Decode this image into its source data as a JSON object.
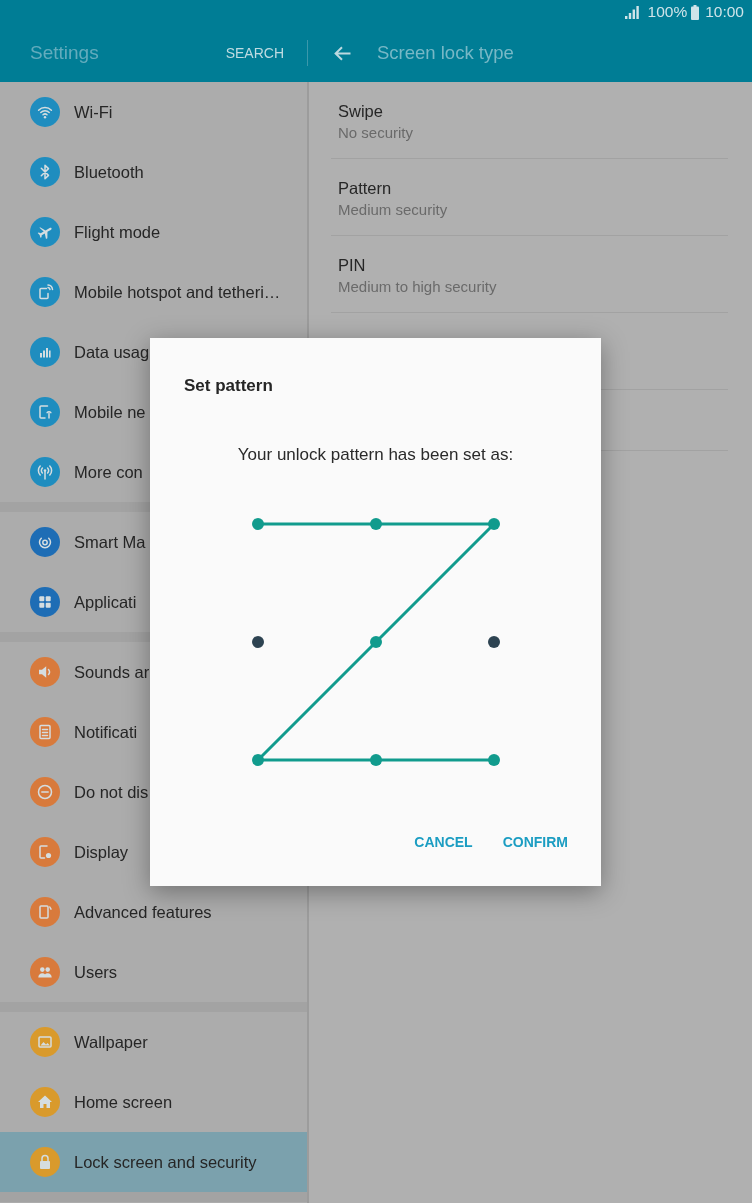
{
  "status_bar": {
    "battery": "100%",
    "time": "10:00"
  },
  "header": {
    "title": "Settings",
    "search": "SEARCH",
    "page_title": "Screen lock type"
  },
  "sidebar": {
    "groups": [
      {
        "items": [
          {
            "label": "Wi-Fi",
            "color": "#1f8dbf",
            "selected": false
          },
          {
            "label": "Bluetooth",
            "color": "#1f8dbf",
            "selected": false
          },
          {
            "label": "Flight mode",
            "color": "#1f8dbf",
            "selected": false
          },
          {
            "label": "Mobile hotspot and tetheri…",
            "color": "#1f8dbf",
            "selected": false
          },
          {
            "label": "Data usag",
            "color": "#1f8dbf",
            "selected": false
          },
          {
            "label": "Mobile ne",
            "color": "#1f8dbf",
            "selected": false
          },
          {
            "label": "More con",
            "color": "#1f8dbf",
            "selected": false
          }
        ]
      },
      {
        "items": [
          {
            "label": "Smart Ma",
            "color": "#1e6db5",
            "selected": false
          },
          {
            "label": "Applicati",
            "color": "#1e6db5",
            "selected": false
          }
        ]
      },
      {
        "items": [
          {
            "label": "Sounds ar",
            "color": "#d87a3c",
            "selected": false
          },
          {
            "label": "Notificati",
            "color": "#d87a3c",
            "selected": false
          },
          {
            "label": "Do not dis",
            "color": "#d87a3c",
            "selected": false
          },
          {
            "label": "Display",
            "color": "#d87a3c",
            "selected": false
          },
          {
            "label": "Advanced features",
            "color": "#d87a3c",
            "selected": false
          },
          {
            "label": "Users",
            "color": "#d87a3c",
            "selected": false
          }
        ]
      },
      {
        "items": [
          {
            "label": "Wallpaper",
            "color": "#d99a2c",
            "selected": false
          },
          {
            "label": "Home screen",
            "color": "#d99a2c",
            "selected": false
          },
          {
            "label": "Lock screen and security",
            "color": "#d99a2c",
            "selected": true
          }
        ]
      }
    ]
  },
  "lock_types": [
    {
      "title": "Swipe",
      "subtitle": "No security"
    },
    {
      "title": "Pattern",
      "subtitle": "Medium security"
    },
    {
      "title": "PIN",
      "subtitle": "Medium to high security"
    }
  ],
  "dialog": {
    "title": "Set pattern",
    "message": "Your unlock pattern has been set as:",
    "pattern": {
      "dots": [
        {
          "selected": true
        },
        {
          "selected": true
        },
        {
          "selected": true
        },
        {
          "selected": false
        },
        {
          "selected": true
        },
        {
          "selected": false
        },
        {
          "selected": true
        },
        {
          "selected": true
        },
        {
          "selected": true
        }
      ]
    },
    "buttons": [
      "CANCEL",
      "CONFIRM"
    ]
  }
}
